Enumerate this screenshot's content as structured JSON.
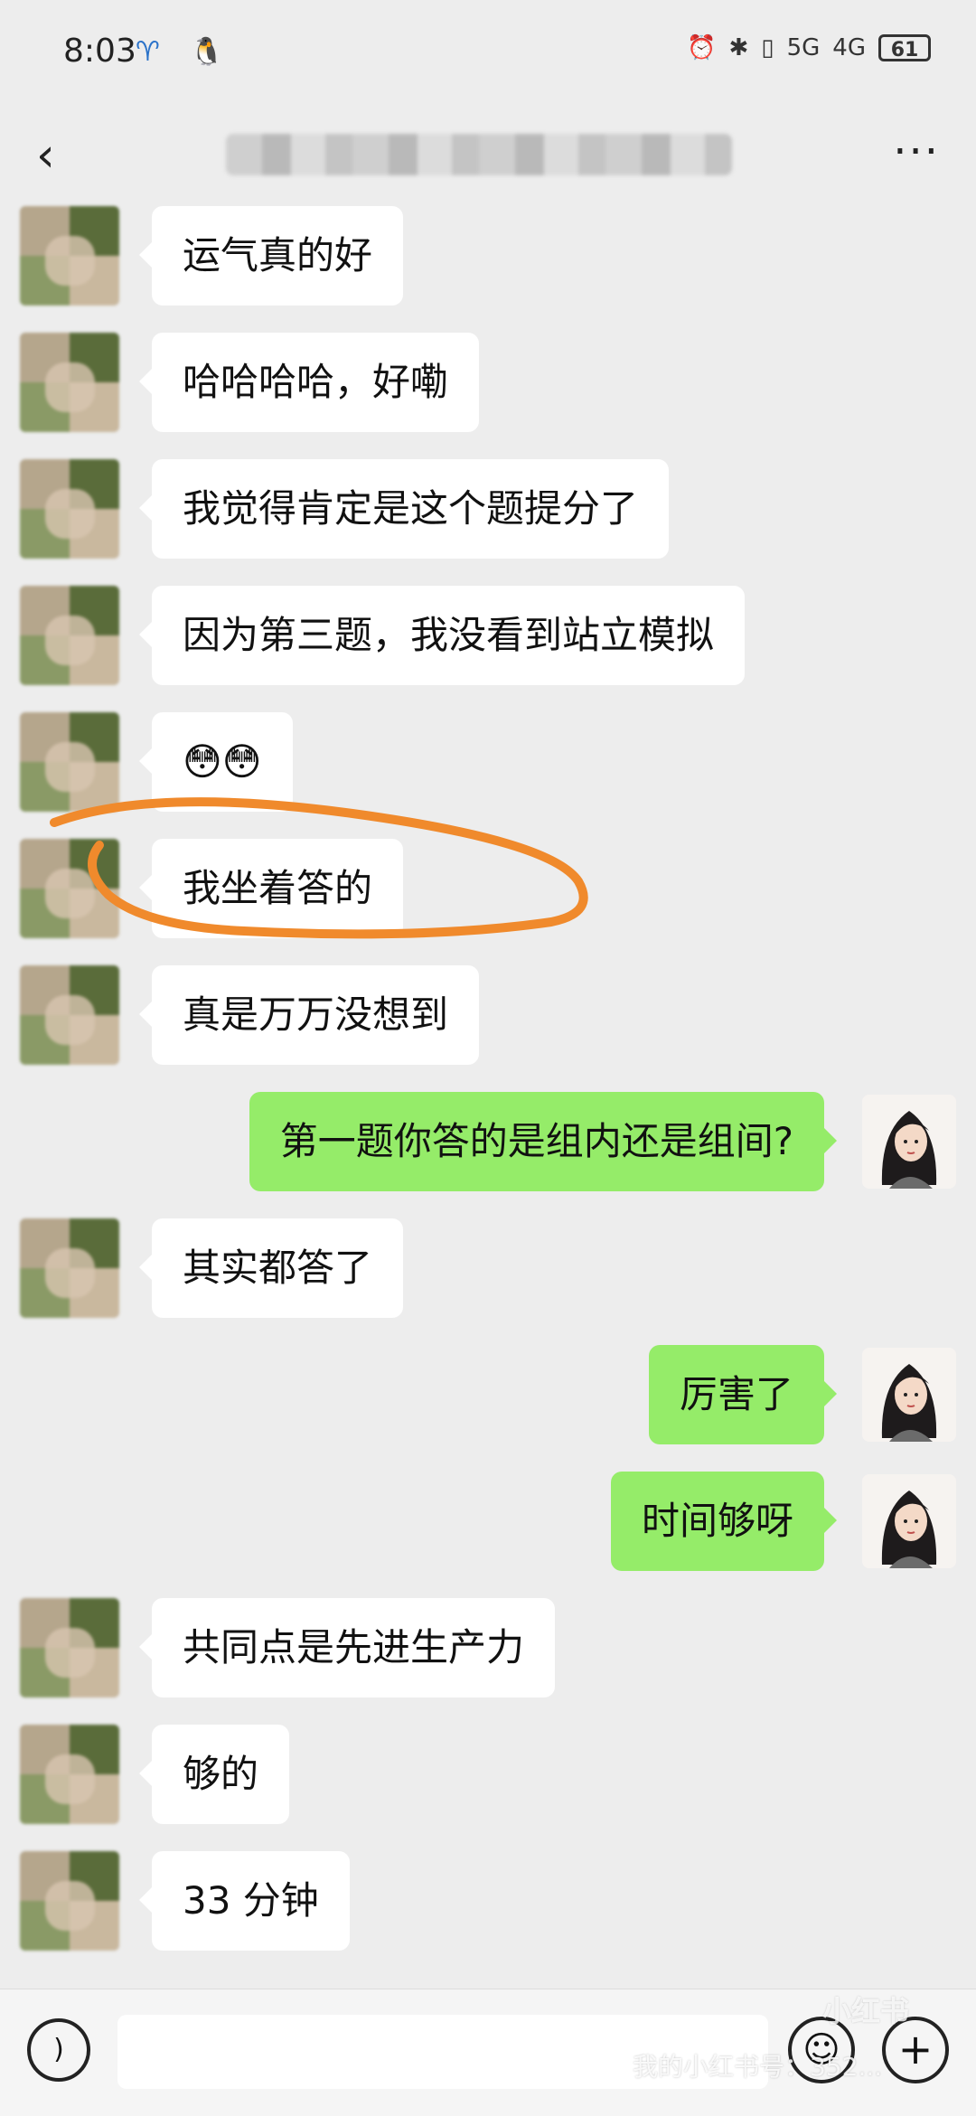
{
  "status_bar": {
    "time": "8:03",
    "app_icons": "♈ 🐧",
    "indicators": [
      "⏰",
      "✱",
      "▯",
      "5G",
      "4G"
    ],
    "battery": "61"
  },
  "nav": {
    "title": "██████ ████████ ██ █"
  },
  "messages": [
    {
      "side": "left",
      "text": "运气真的好"
    },
    {
      "side": "left",
      "text": "哈哈哈哈，好嘞"
    },
    {
      "side": "left",
      "text": "我觉得肯定是这个题提分了"
    },
    {
      "side": "left",
      "text": "因为第三题，我没看到站立模拟"
    },
    {
      "side": "left",
      "text": "😳😳"
    },
    {
      "side": "left",
      "text": "我坐着答的"
    },
    {
      "side": "left",
      "text": "真是万万没想到"
    },
    {
      "side": "right",
      "text": "第一题你答的是组内还是组间?"
    },
    {
      "side": "left",
      "text": "其实都答了"
    },
    {
      "side": "right",
      "text": "厉害了"
    },
    {
      "side": "right",
      "text": "时间够呀"
    },
    {
      "side": "left",
      "text": "共同点是先进生产力"
    },
    {
      "side": "left",
      "text": "够的"
    },
    {
      "side": "left",
      "text": "33 分钟"
    }
  ],
  "input_bar": {
    "watermark_text": "我的小红书号：352...",
    "watermark_logo": "小红书"
  },
  "colors": {
    "background": "#ededed",
    "bubble_left": "#ffffff",
    "bubble_right": "#95ec69",
    "annotation": "#f08a2c"
  }
}
